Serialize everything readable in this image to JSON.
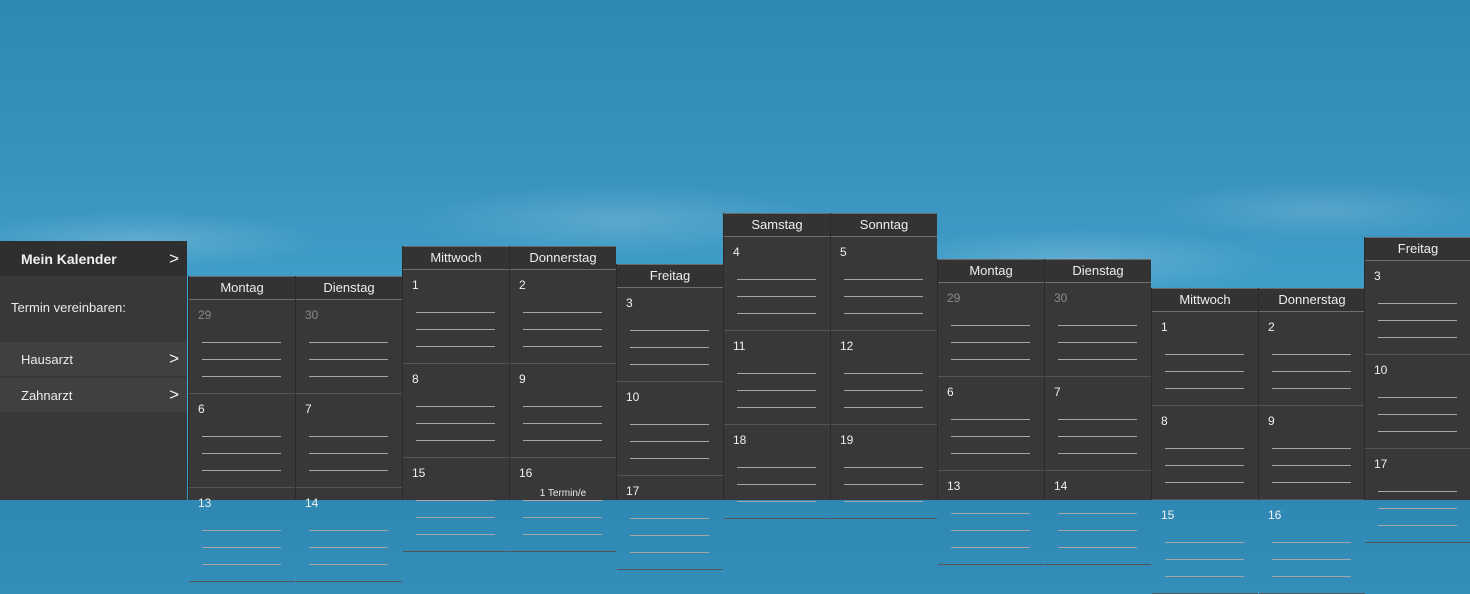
{
  "sidebar": {
    "title": "Mein Kalender",
    "title_chevron": ">",
    "section_label": "Termin vereinbaren:",
    "items": [
      {
        "label": "Hausarzt",
        "chevron": ">"
      },
      {
        "label": "Zahnarzt",
        "chevron": ">"
      }
    ]
  },
  "columns": [
    {
      "day": "Montag",
      "cells": [
        {
          "n": "29",
          "dim": true
        },
        {
          "n": "6"
        },
        {
          "n": "13"
        }
      ]
    },
    {
      "day": "Dienstag",
      "cells": [
        {
          "n": "30",
          "dim": true
        },
        {
          "n": "7"
        },
        {
          "n": "14"
        }
      ]
    },
    {
      "day": "Mittwoch",
      "cells": [
        {
          "n": "1"
        },
        {
          "n": "8"
        },
        {
          "n": "15"
        }
      ]
    },
    {
      "day": "Donnerstag",
      "cells": [
        {
          "n": "2"
        },
        {
          "n": "9"
        },
        {
          "n": "16",
          "badge": "1 Termin/e"
        }
      ]
    },
    {
      "day": "Freitag",
      "cells": [
        {
          "n": "3"
        },
        {
          "n": "10"
        },
        {
          "n": "17"
        }
      ]
    },
    {
      "day": "Samstag",
      "cells": [
        {
          "n": "4"
        },
        {
          "n": "11"
        },
        {
          "n": "18"
        }
      ]
    },
    {
      "day": "Sonntag",
      "cells": [
        {
          "n": "5"
        },
        {
          "n": "12"
        },
        {
          "n": "19"
        }
      ]
    },
    {
      "day": "Montag",
      "cells": [
        {
          "n": "29",
          "dim": true
        },
        {
          "n": "6"
        },
        {
          "n": "13"
        }
      ]
    },
    {
      "day": "Dienstag",
      "cells": [
        {
          "n": "30",
          "dim": true
        },
        {
          "n": "7"
        },
        {
          "n": "14"
        }
      ]
    },
    {
      "day": "Mittwoch",
      "cells": [
        {
          "n": "1"
        },
        {
          "n": "8"
        },
        {
          "n": "15"
        }
      ]
    },
    {
      "day": "Donnerstag",
      "cells": [
        {
          "n": "2"
        },
        {
          "n": "9"
        },
        {
          "n": "16"
        }
      ]
    },
    {
      "day": "Freitag",
      "cells": [
        {
          "n": "3"
        },
        {
          "n": "10"
        },
        {
          "n": "17"
        }
      ]
    }
  ]
}
